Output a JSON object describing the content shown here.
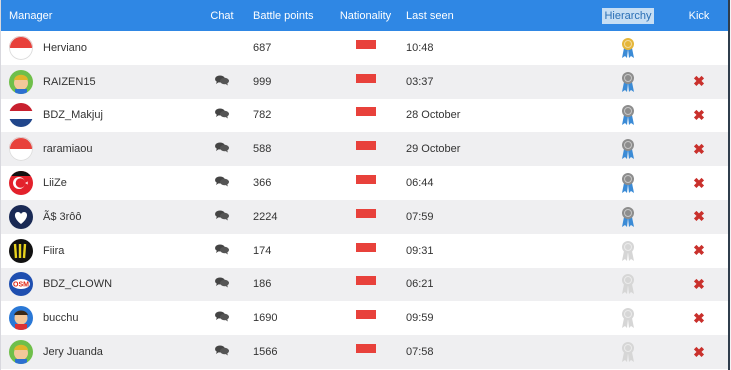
{
  "columns": {
    "manager": "Manager",
    "chat": "Chat",
    "battle_points": "Battle points",
    "nationality": "Nationality",
    "last_seen": "Last seen",
    "hierarchy": "Hierarchy",
    "kick": "Kick"
  },
  "colors": {
    "header_bg": "#2f87e4",
    "flag_red": "#e8413b",
    "kick_red": "#c9302c"
  },
  "rows": [
    {
      "name": "Herviano",
      "avatar": "flag-indonesia-icon",
      "chat": false,
      "points": "687",
      "last_seen": "10:48",
      "medal": "gold",
      "kick": false
    },
    {
      "name": "RAIZEN15",
      "avatar": "cartoon-face-icon",
      "chat": true,
      "points": "999",
      "last_seen": "03:37",
      "medal": "silver",
      "kick": true
    },
    {
      "name": "BDZ_Makjuj",
      "avatar": "flag-netherlands-icon",
      "chat": true,
      "points": "782",
      "last_seen": "28 October",
      "medal": "silver",
      "kick": true
    },
    {
      "name": "raramiaou",
      "avatar": "flag-indonesia-icon",
      "chat": true,
      "points": "588",
      "last_seen": "29 October",
      "medal": "silver",
      "kick": true
    },
    {
      "name": "LiiZe",
      "avatar": "flag-turkey-icon",
      "chat": true,
      "points": "366",
      "last_seen": "06:44",
      "medal": "silver",
      "kick": true
    },
    {
      "name": "Ã$ 3rôô",
      "avatar": "heart-icon",
      "chat": true,
      "points": "2224",
      "last_seen": "07:59",
      "medal": "silver",
      "kick": true
    },
    {
      "name": "Fiira",
      "avatar": "monster-logo-icon",
      "chat": true,
      "points": "174",
      "last_seen": "09:31",
      "medal": "grey",
      "kick": true
    },
    {
      "name": "BDZ_CLOWN",
      "avatar": "badge-logo-icon",
      "chat": true,
      "points": "186",
      "last_seen": "06:21",
      "medal": "grey",
      "kick": true
    },
    {
      "name": "bucchu",
      "avatar": "cartoon-boy-icon",
      "chat": true,
      "points": "1690",
      "last_seen": "09:59",
      "medal": "grey",
      "kick": true
    },
    {
      "name": "Jery Juanda",
      "avatar": "cartoon-face-icon",
      "chat": true,
      "points": "1566",
      "last_seen": "07:58",
      "medal": "grey",
      "kick": true
    }
  ]
}
